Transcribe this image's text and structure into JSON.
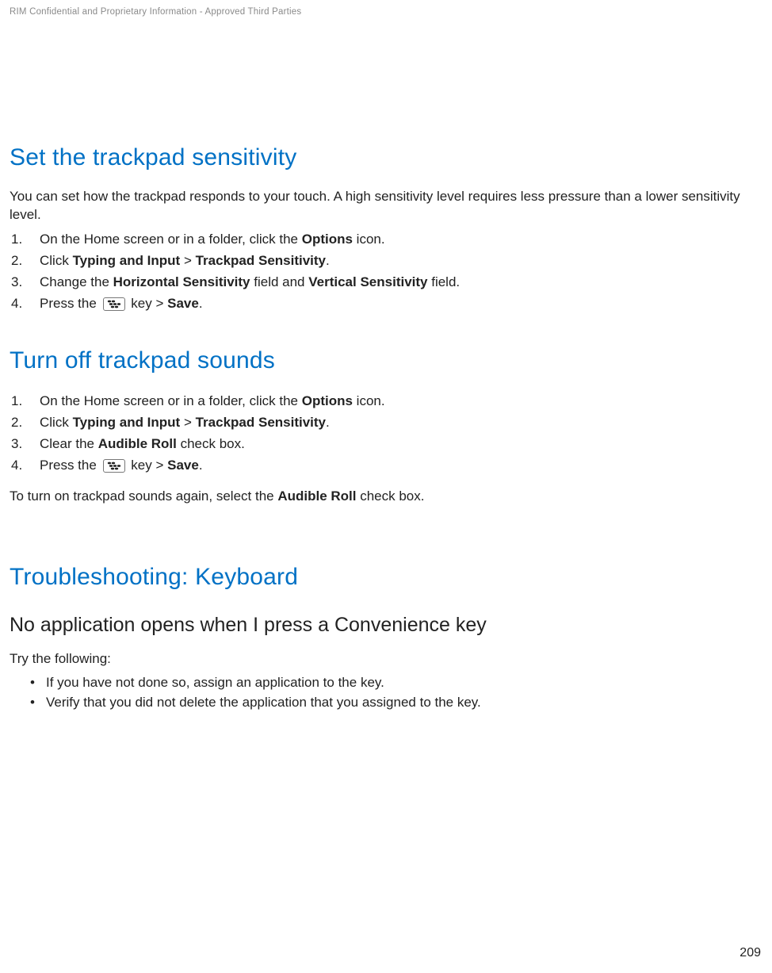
{
  "header": {
    "confidential": "RIM Confidential and Proprietary Information - Approved Third Parties"
  },
  "section1": {
    "title": "Set the trackpad sensitivity",
    "intro": "You can set how the trackpad responds to your touch. A high sensitivity level requires less pressure than a lower sensitivity level.",
    "steps": [
      {
        "n": "1.",
        "pre": "On the Home screen or in a folder, click the ",
        "b1": "Options",
        "post": " icon."
      },
      {
        "n": "2.",
        "pre": "Click ",
        "b1": "Typing and Input",
        "mid": " > ",
        "b2": "Trackpad Sensitivity",
        "post": "."
      },
      {
        "n": "3.",
        "pre": "Change the ",
        "b1": "Horizontal Sensitivity",
        "mid": " field and ",
        "b2": "Vertical Sensitivity",
        "post": " field."
      },
      {
        "n": "4.",
        "pre": "Press the ",
        "icon": true,
        "mid": " key > ",
        "b1": "Save",
        "post": "."
      }
    ]
  },
  "section2": {
    "title": "Turn off trackpad sounds",
    "steps": [
      {
        "n": "1.",
        "pre": "On the Home screen or in a folder, click the ",
        "b1": "Options",
        "post": " icon."
      },
      {
        "n": "2.",
        "pre": "Click ",
        "b1": "Typing and Input",
        "mid": " > ",
        "b2": "Trackpad Sensitivity",
        "post": "."
      },
      {
        "n": "3.",
        "pre": "Clear the ",
        "b1": "Audible Roll",
        "post": " check box."
      },
      {
        "n": "4.",
        "pre": "Press the ",
        "icon": true,
        "mid": " key > ",
        "b1": "Save",
        "post": "."
      }
    ],
    "outro_pre": "To turn on trackpad sounds again, select the ",
    "outro_b": "Audible Roll",
    "outro_post": " check box."
  },
  "section3": {
    "title": "Troubleshooting: Keyboard",
    "sub1": {
      "title": "No application opens when I press a Convenience key",
      "intro": "Try the following:",
      "bullets": [
        "If you have not done so, assign an application to the key.",
        "Verify that you did not delete the application that you assigned to the key."
      ]
    }
  },
  "pageNumber": "209"
}
